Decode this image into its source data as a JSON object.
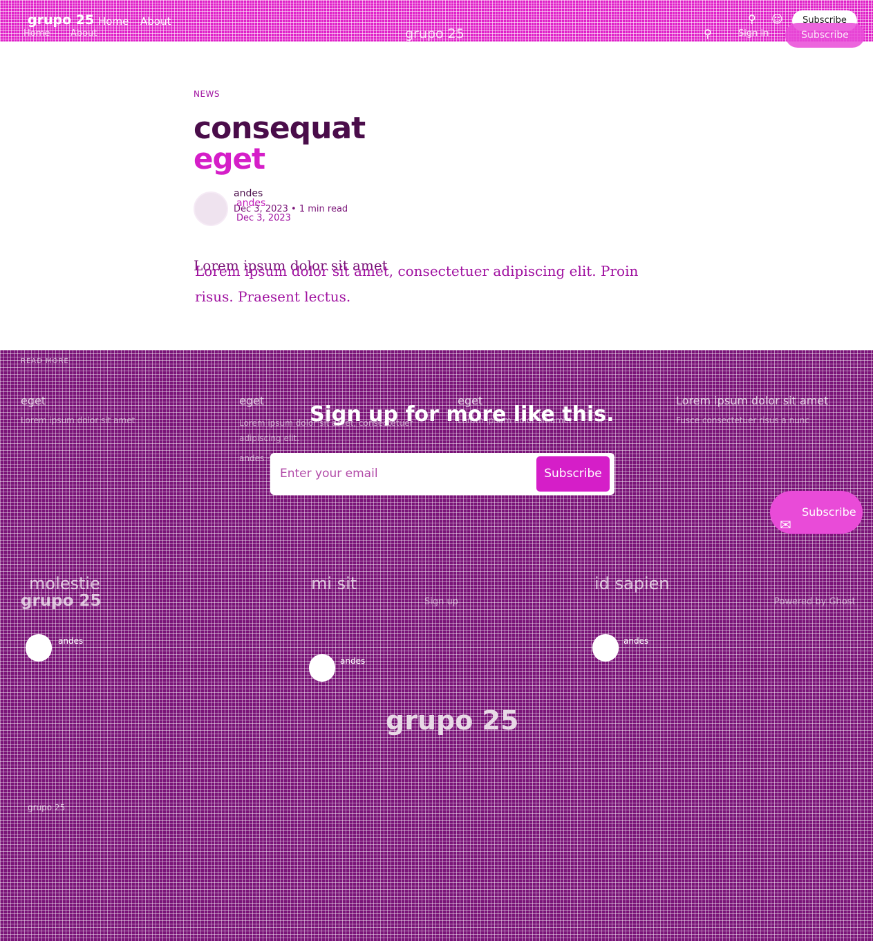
{
  "header": {
    "brand": "grupo 25",
    "nav": [
      {
        "label": "Home"
      },
      {
        "label": "About"
      }
    ],
    "search_icon": "search-icon",
    "account_icon": "user-icon",
    "signin_label": "Sign in",
    "subscribe_label": "Subscribe"
  },
  "article": {
    "tag": "NEWS",
    "title_line1": "consequat",
    "title_line2": "eget",
    "author": "andes",
    "date": "Dec 3, 2023",
    "read_time": "1 min read",
    "meta": "Dec 3, 2023 • 1 min read",
    "body_overlap": "Lorem ipsum dolor sit amet",
    "body": "Lorem ipsum dolor sit amet, consectetuer adipiscing elit. Proin risus. Praesent lectus."
  },
  "signup": {
    "title": "Sign up for more like this.",
    "placeholder": "Enter your email",
    "button_label": "Subscribe"
  },
  "read_more": {
    "heading": "READ MORE",
    "cards": [
      {
        "title": "eget",
        "excerpt": "Lorem ipsum dolor sit amet",
        "meta": ""
      },
      {
        "title": "eget",
        "excerpt": "Lorem ipsum dolor sit amet, consectetuer adipiscing elit.",
        "meta": "andes · Dec 3, 2023"
      },
      {
        "title": "eget",
        "excerpt": "Lorem ipsum dolor sit amet",
        "meta": ""
      },
      {
        "title": "Lorem ipsum dolor sit amet",
        "excerpt": "Fusce consectetuer risus a nunc",
        "meta": ""
      }
    ],
    "second_row": [
      {
        "title": "molestie",
        "author": "andes"
      },
      {
        "title": "mi sit",
        "author": "andes"
      },
      {
        "title": "id sapien",
        "author": "andes"
      }
    ]
  },
  "floating_subscribe": {
    "label": "Subscribe",
    "icon": "bell-icon"
  },
  "footer": {
    "brand": "grupo 25",
    "signup_link": "Sign up",
    "powered_by": "Powered by Ghost",
    "big_brand": "grupo 25",
    "small_brand": "grupo 25"
  },
  "colors": {
    "header_bg": "#e020c8",
    "section_bg": "#7a1478",
    "accent": "#d51ec8",
    "title_dark": "#4a0d4a"
  }
}
